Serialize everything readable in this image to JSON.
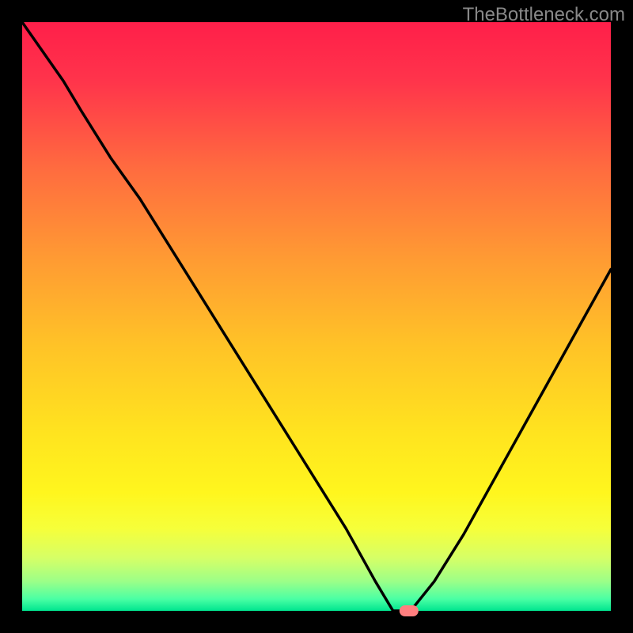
{
  "watermark": "TheBottleneck.com",
  "chart_data": {
    "type": "line",
    "title": "",
    "xlabel": "",
    "ylabel": "",
    "x": [
      0.0,
      0.07,
      0.1,
      0.15,
      0.2,
      0.25,
      0.3,
      0.35,
      0.4,
      0.45,
      0.5,
      0.55,
      0.6,
      0.63,
      0.66,
      0.7,
      0.75,
      0.8,
      0.85,
      0.9,
      0.95,
      1.0
    ],
    "values": [
      1.0,
      0.9,
      0.85,
      0.77,
      0.7,
      0.62,
      0.54,
      0.46,
      0.38,
      0.3,
      0.22,
      0.14,
      0.05,
      0.0,
      0.0,
      0.05,
      0.13,
      0.22,
      0.31,
      0.4,
      0.49,
      0.58
    ],
    "xlim": [
      0,
      1
    ],
    "ylim": [
      0,
      1
    ],
    "marker_point": {
      "x": 0.657,
      "y": 0.0
    },
    "notes": "Background is a vertical gradient from red at top through orange/yellow to green at the bottom inside a black-bordered plot area. A single black curve descends from top-left to a minimum near x≈0.64, has a small flat bottom, then rises to the right. A small coral marker sits at the minimum. No axis ticks, labels, or legend are visible."
  }
}
